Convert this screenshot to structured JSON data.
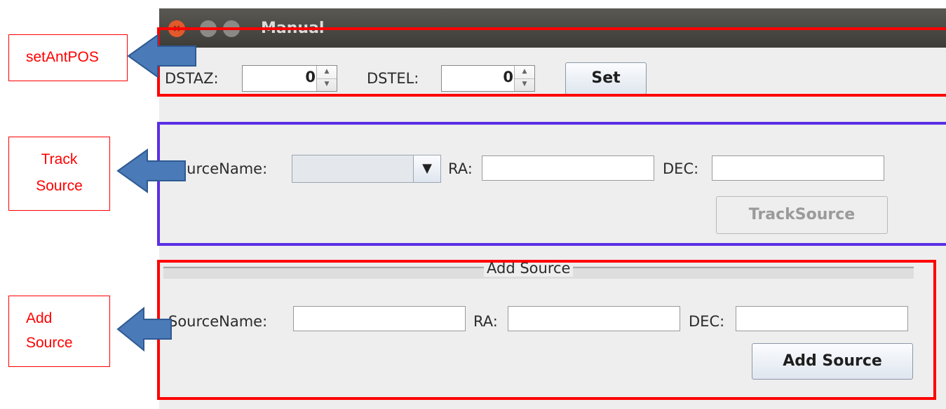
{
  "window": {
    "title": "Manual"
  },
  "set_ant_pos": {
    "dstaz_label": "DSTAZ:",
    "dstaz_value": "0",
    "dstel_label": "DSTEL:",
    "dstel_value": "0",
    "set_button": "Set"
  },
  "track_source": {
    "source_name_label": "SourceName:",
    "source_name_selected": "",
    "ra_label": "RA:",
    "ra_value": "",
    "dec_label": "DEC:",
    "dec_value": "",
    "track_button": "TrackSource"
  },
  "add_source": {
    "group_title": "Add Source",
    "source_name_label": "SourceName:",
    "source_name_value": "",
    "ra_label": "RA:",
    "ra_value": "",
    "dec_label": "DEC:",
    "dec_value": "",
    "add_button": "Add Source"
  },
  "annotations": {
    "callout1": "setAntPOS",
    "callout2_line1": "Track",
    "callout2_line2": "Source",
    "callout3_line1": "Add",
    "callout3_line2": "Source",
    "red_color": "#ff0000",
    "blue_color": "#5b2ee6",
    "arrow_color": "#4a7ab8"
  }
}
